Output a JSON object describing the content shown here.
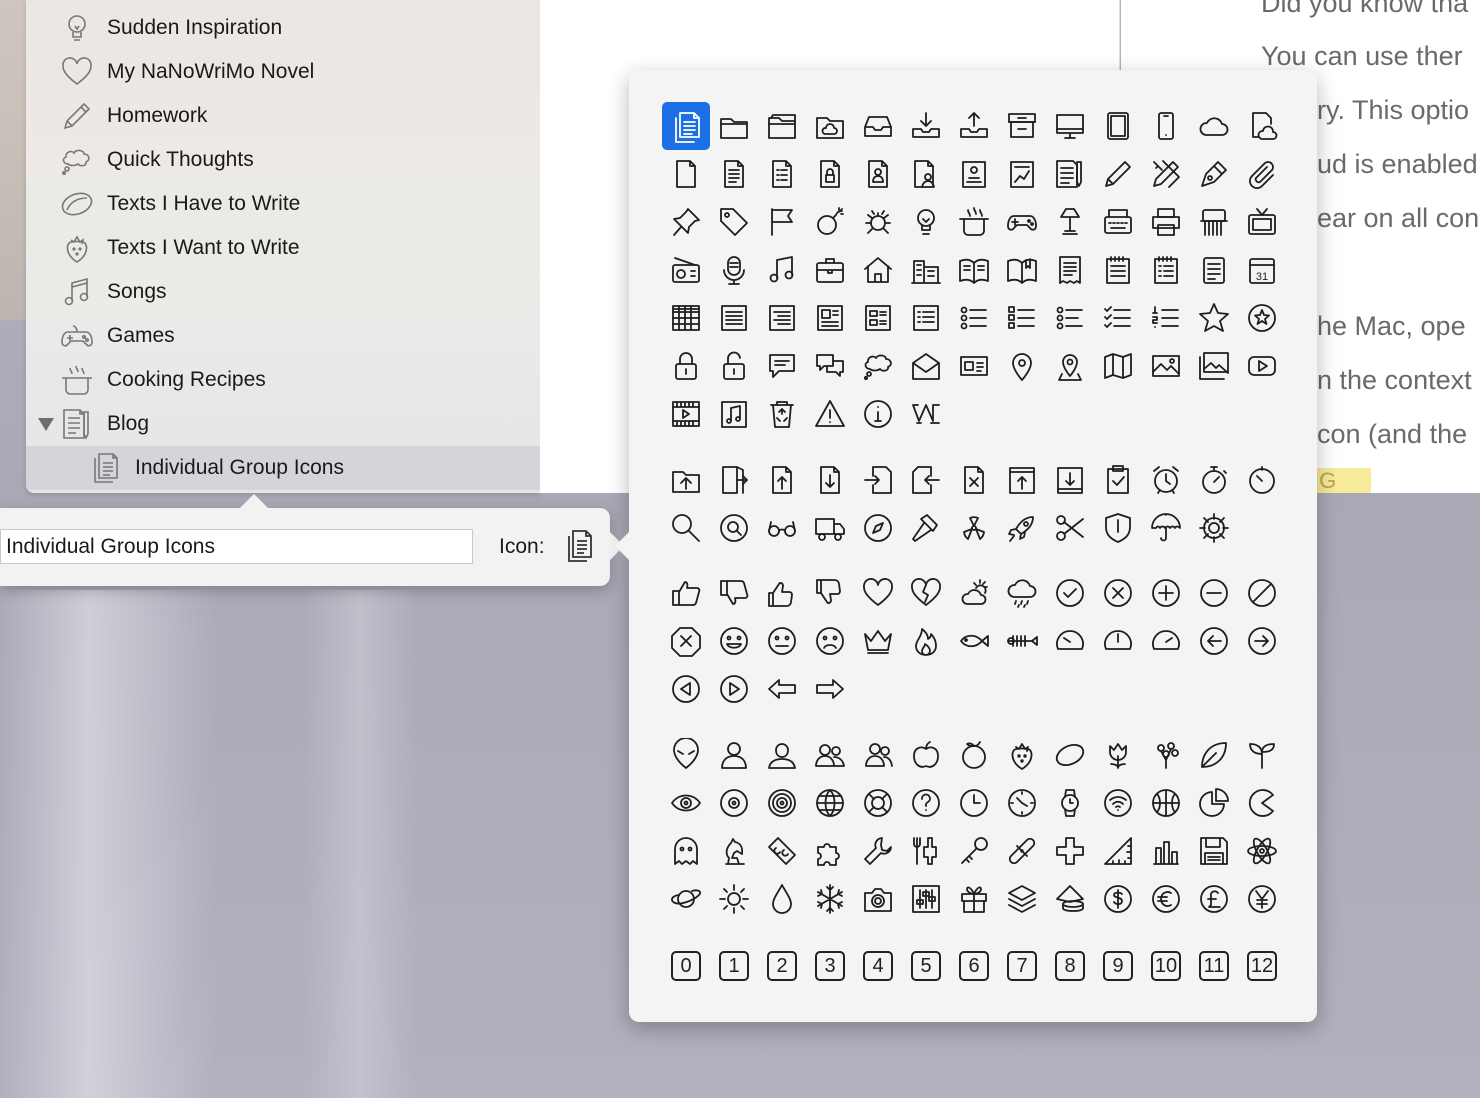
{
  "sidebar": {
    "items": [
      {
        "label": "Sudden Inspiration",
        "icon": "lightbulb-icon"
      },
      {
        "label": "My NaNoWriMo Novel",
        "icon": "heart-icon"
      },
      {
        "label": "Homework",
        "icon": "pencil-icon"
      },
      {
        "label": "Quick Thoughts",
        "icon": "thought-bubble-icon"
      },
      {
        "label": "Texts I Have to Write",
        "icon": "lemon-icon"
      },
      {
        "label": "Texts I Want to Write",
        "icon": "strawberry-icon"
      },
      {
        "label": "Songs",
        "icon": "music-note-icon"
      },
      {
        "label": "Games",
        "icon": "gamepad-icon"
      },
      {
        "label": "Cooking Recipes",
        "icon": "cooking-pot-icon"
      },
      {
        "label": "Blog",
        "icon": "document-pencil-icon"
      },
      {
        "label": "Individual Group Icons",
        "icon": "documents-icon"
      }
    ]
  },
  "editor": {
    "lines": [
      "Did you know tha",
      "You can use ther",
      "ry. This optio",
      "ud is enabled",
      "ear on all con",
      "he Mac, ope",
      "n the context",
      "con (and the"
    ],
    "highlight": "IG"
  },
  "group_popover": {
    "name_value": "Individual Group Icons",
    "icon_label": "Icon:",
    "icon_name": "documents-icon"
  },
  "picker": {
    "selected_icon": "documents-icon",
    "sections": [
      [
        "documents",
        "folder",
        "folder-open",
        "folder-cloud",
        "inbox-tray",
        "tray-download",
        "tray-upload",
        "archive-box",
        "monitor",
        "tablet",
        "phone",
        "cloud",
        "doc-cloud",
        "blank-doc",
        "text-doc",
        "list-doc",
        "lock-doc",
        "person-doc",
        "person-doc2",
        "id-doc",
        "chart-doc",
        "doc-pencil",
        "pencil",
        "pencil-ruler",
        "fountain-pen",
        "paperclip",
        "pushpin",
        "tag",
        "flag",
        "bomb",
        "bug",
        "lightbulb",
        "cooking-pot",
        "gamepad",
        "lamp",
        "typewriter",
        "printer",
        "shredder",
        "tv",
        "radio",
        "microphone",
        "music-note",
        "briefcase",
        "house",
        "buildings",
        "open-book",
        "book-bookmark",
        "receipt",
        "notepad",
        "checklist-pad",
        "memo",
        "calendar",
        "grid",
        "align-left",
        "align-right",
        "newspaper",
        "layout",
        "text-list",
        "bullet-list",
        "bullet-list2",
        "bullet-list3",
        "checklist",
        "numbered-list",
        "star",
        "star-circle",
        "lock",
        "unlock",
        "speech-bubble",
        "chat",
        "thought-bubble",
        "envelope-open",
        "id-card",
        "map-pin",
        "map-pin-flag",
        "map",
        "picture",
        "pictures",
        "play-button",
        "film",
        "music-file",
        "recycle-bin",
        "warning",
        "info",
        "medium-logo"
      ],
      [
        "folder-upload",
        "exit-door",
        "file-up",
        "file-down",
        "file-import",
        "file-export",
        "file-x",
        "upload-box",
        "download-box",
        "clipboard-check",
        "alarm-clock",
        "stopwatch",
        "timer",
        "magnifier",
        "zoom",
        "glasses",
        "truck",
        "compass",
        "hammer",
        "radiation",
        "rocket",
        "scissors",
        "shield",
        "umbrella",
        "gear"
      ],
      [
        "thumbs-up",
        "thumbs-down",
        "thumbs-up2",
        "thumbs-down2",
        "heart",
        "broken-heart",
        "partly-sunny",
        "rain-cloud",
        "check-circle",
        "x-circle",
        "plus-circle",
        "minus-circle",
        "no-circle",
        "stop-octagon",
        "smile",
        "neutral",
        "sad",
        "crown",
        "fire",
        "fish",
        "fish-bone",
        "gauge-low",
        "gauge-mid",
        "gauge-high",
        "arrow-left-circle",
        "arrow-right-circle",
        "play-left-circle",
        "play-right-circle",
        "arrow-left",
        "arrow-right"
      ],
      [
        "alien",
        "person",
        "person2",
        "people",
        "people2",
        "apple",
        "orange",
        "strawberry",
        "lemon",
        "tulip",
        "flowers",
        "leaf",
        "sprout",
        "eye",
        "target",
        "target2",
        "globe",
        "lifebuoy",
        "question",
        "clock",
        "clock2",
        "watch",
        "wifi",
        "basketball",
        "pie-chart",
        "pacman",
        "ghost",
        "chess-knight",
        "tape",
        "puzzle",
        "wrench",
        "tools",
        "key",
        "bandage",
        "plus",
        "triangle-ruler",
        "bar-chart",
        "floppy",
        "atom",
        "planet",
        "sun",
        "drop",
        "snowflake",
        "camera",
        "sliders",
        "gift",
        "layers",
        "coins",
        "dollar",
        "euro",
        "pound",
        "yen"
      ],
      [
        "0",
        "1",
        "2",
        "3",
        "4",
        "5",
        "6",
        "7",
        "8",
        "9",
        "10",
        "11",
        "12"
      ]
    ]
  }
}
